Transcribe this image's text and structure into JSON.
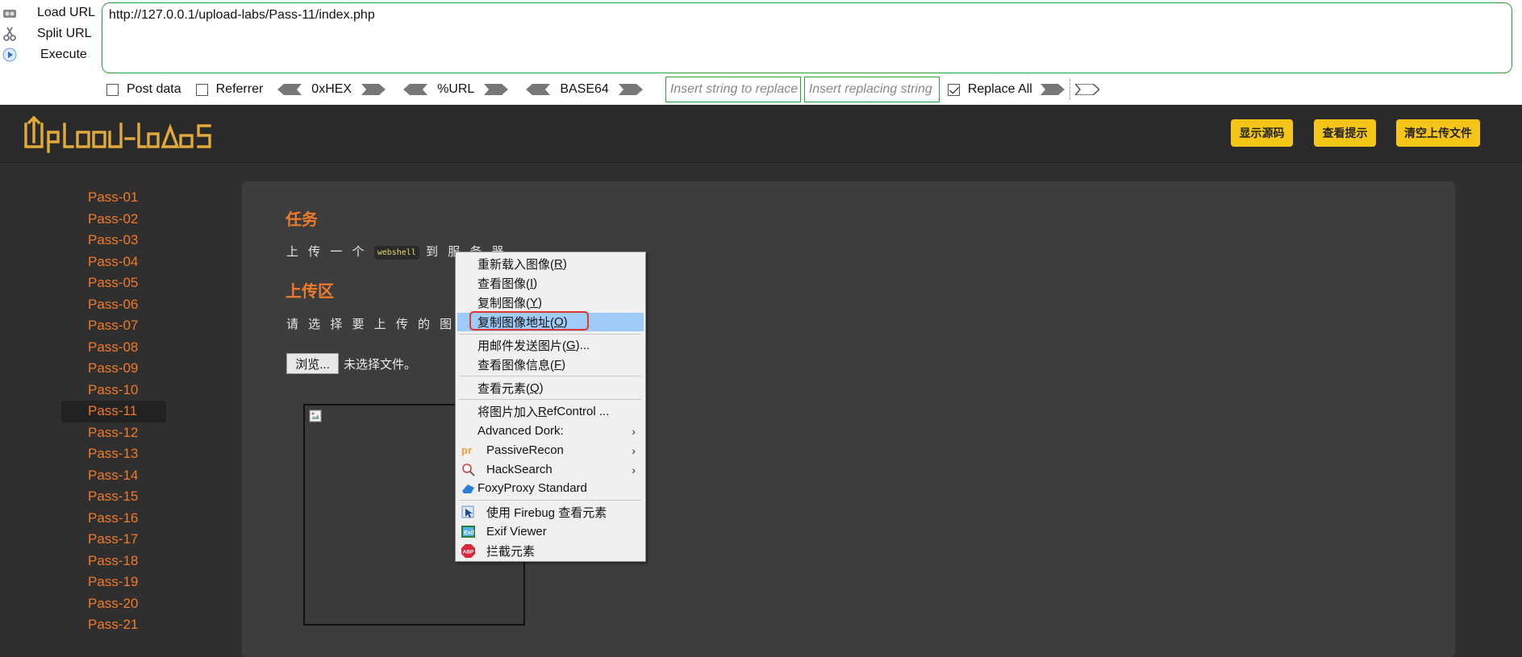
{
  "hackbar": {
    "load_url": "Load URL",
    "split_url": "Split URL",
    "execute": "Execute",
    "url": "http://127.0.0.1/upload-labs/Pass-11/index.php",
    "post_data": "Post data",
    "referrer": "Referrer",
    "hex": "0xHEX",
    "url_enc": "%URL",
    "base64": "BASE64",
    "replace_placeholder": "Insert string to replace",
    "replacing_placeholder": "Insert replacing string",
    "replace_all": "Replace All",
    "replace_all_checked": true,
    "accent": "#27a43a"
  },
  "header": {
    "logo": "UpLoad-labs",
    "buttons": [
      "显示源码",
      "查看提示",
      "清空上传文件"
    ],
    "button_color": "#f5c518"
  },
  "sidebar": {
    "items": [
      "Pass-01",
      "Pass-02",
      "Pass-03",
      "Pass-04",
      "Pass-05",
      "Pass-06",
      "Pass-07",
      "Pass-08",
      "Pass-09",
      "Pass-10",
      "Pass-11",
      "Pass-12",
      "Pass-13",
      "Pass-14",
      "Pass-15",
      "Pass-16",
      "Pass-17",
      "Pass-18",
      "Pass-19",
      "Pass-20",
      "Pass-21"
    ],
    "active": "Pass-11",
    "color": "#f07a2a"
  },
  "main": {
    "task_title": "任务",
    "task_prefix": "上 传 一 个",
    "task_code": "webshell",
    "task_suffix": "到 服 务 器",
    "upload_title": "上传区",
    "select_label": "请 选 择 要 上 传 的 图 片 ：",
    "browse": "浏览...",
    "file_status": "未选择文件。"
  },
  "context_menu": {
    "items": [
      {
        "label": "重新载入图像(",
        "key": "R",
        "tail": ")"
      },
      {
        "label": "查看图像(",
        "key": "I",
        "tail": ")"
      },
      {
        "label": "复制图像(",
        "key": "Y",
        "tail": ")"
      },
      {
        "label": "复制图像地址(",
        "key": "O",
        "tail": ")"
      },
      {
        "label": "用邮件发送图片(",
        "key": "G",
        "tail": ")..."
      },
      {
        "label": "查看图像信息(",
        "key": "F",
        "tail": ")"
      },
      {
        "label": "查看元素(",
        "key": "Q",
        "tail": ")"
      },
      {
        "label": "将图片加入 ",
        "key": "R",
        "tail": "efControl ..."
      },
      {
        "label": "Advanced Dork:",
        "key": "",
        "tail": ""
      },
      {
        "label": "PassiveRecon",
        "key": "",
        "tail": ""
      },
      {
        "label": "HackSearch",
        "key": "",
        "tail": ""
      },
      {
        "label": "FoxyProxy Standard",
        "key": "",
        "tail": ""
      },
      {
        "label": "使用 Firebug 查看元素",
        "key": "",
        "tail": ""
      },
      {
        "label": "Exif Viewer",
        "key": "",
        "tail": ""
      },
      {
        "label": "拦截元素",
        "key": "",
        "tail": ""
      }
    ],
    "highlighted": "复制图像地址(O)",
    "highlight_color": "#9ecbf7",
    "ring_color": "#e0342f"
  }
}
